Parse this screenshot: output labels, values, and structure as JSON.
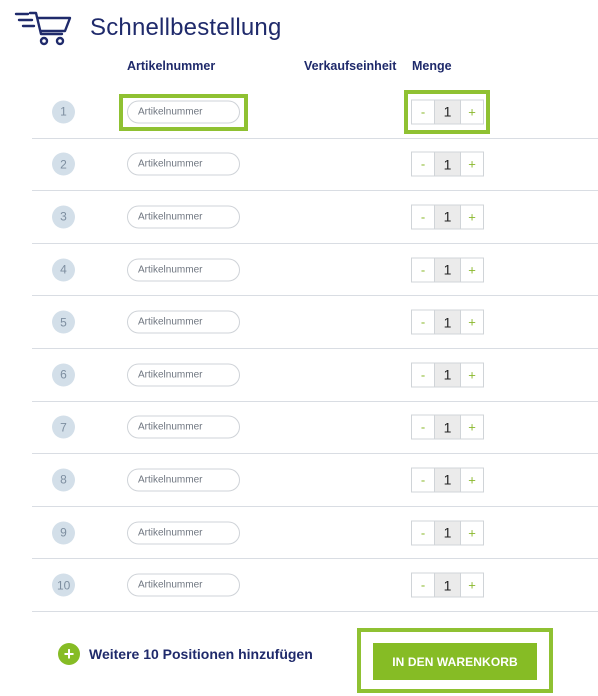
{
  "header": {
    "title": "Schnellbestellung",
    "icon": "quick-cart-icon"
  },
  "columns": {
    "article": "Artikelnummer",
    "unit": "Verkaufseinheit",
    "quantity": "Menge"
  },
  "rows": [
    {
      "number": "1",
      "placeholder": "Artikelnummer",
      "quantity": "1"
    },
    {
      "number": "2",
      "placeholder": "Artikelnummer",
      "quantity": "1"
    },
    {
      "number": "3",
      "placeholder": "Artikelnummer",
      "quantity": "1"
    },
    {
      "number": "4",
      "placeholder": "Artikelnummer",
      "quantity": "1"
    },
    {
      "number": "5",
      "placeholder": "Artikelnummer",
      "quantity": "1"
    },
    {
      "number": "6",
      "placeholder": "Artikelnummer",
      "quantity": "1"
    },
    {
      "number": "7",
      "placeholder": "Artikelnummer",
      "quantity": "1"
    },
    {
      "number": "8",
      "placeholder": "Artikelnummer",
      "quantity": "1"
    },
    {
      "number": "9",
      "placeholder": "Artikelnummer",
      "quantity": "1"
    },
    {
      "number": "10",
      "placeholder": "Artikelnummer",
      "quantity": "1"
    }
  ],
  "stepper": {
    "minus": "-",
    "plus": "+"
  },
  "footer": {
    "add_icon": "+",
    "add_label": "Weitere 10 Positionen hinzufügen",
    "cart_button": "IN DEN WARENKORB"
  },
  "colors": {
    "accent_green": "#86bc25",
    "highlight_green": "#8fc132",
    "text_navy": "#1f2a6b",
    "badge_bg": "#d3dfe9"
  }
}
